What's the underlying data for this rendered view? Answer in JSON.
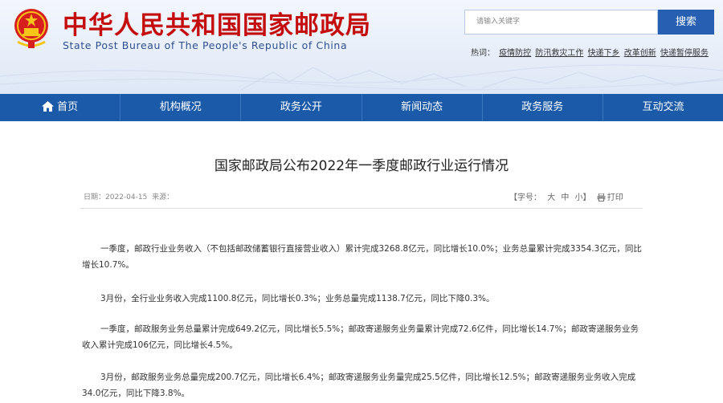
{
  "header": {
    "title_cn": "中华人民共和国国家邮政局",
    "title_en": "State Post Bureau of The People's Republic of China",
    "search_placeholder": "请输入关键字",
    "search_button": "搜索",
    "hotwords_label": "热词：",
    "hotwords": [
      "疫情防控",
      "防汛救灾工作",
      "快递下乡",
      "改革创新",
      "快递暂停服务"
    ]
  },
  "colors": {
    "brand_red": "#c40e0e",
    "nav_blue": "#1b5aa8",
    "search_blue": "#2760b3"
  },
  "nav": {
    "items": [
      {
        "label": "首页",
        "icon": "home-icon"
      },
      {
        "label": "机构概况"
      },
      {
        "label": "政务公开"
      },
      {
        "label": "新闻动态"
      },
      {
        "label": "政务服务"
      },
      {
        "label": "互动交流"
      }
    ]
  },
  "article": {
    "title": "国家邮政局公布2022年一季度邮政行业运行情况",
    "date_label": "日期：",
    "date": "2022-04-15",
    "source_label": "来源：",
    "font_label": "【字号：",
    "font_large": "大",
    "font_medium": "中",
    "font_small": "小】",
    "print": "打印",
    "paragraphs": [
      "一季度，邮政行业业务收入（不包括邮政储蓄银行直接营业收入）累计完成3268.8亿元，同比增长10.0%；业务总量累计完成3354.3亿元，同比增长10.7%。",
      "3月份，全行业业务收入完成1100.8亿元，同比增长0.3%；业务总量完成1138.7亿元，同比下降0.3%。",
      "一季度，邮政服务业务总量累计完成649.2亿元，同比增长5.5%；邮政寄递服务业务量累计完成72.6亿件，同比增长14.7%；邮政寄递服务业务收入累计完成106亿元，同比增长4.5%。",
      "3月份，邮政服务业务总量完成200.7亿元，同比增长6.4%；邮政寄递服务业务量完成25.5亿件，同比增长12.5%；邮政寄递服务业务收入完成34.0亿元，同比下降3.8%。"
    ]
  }
}
